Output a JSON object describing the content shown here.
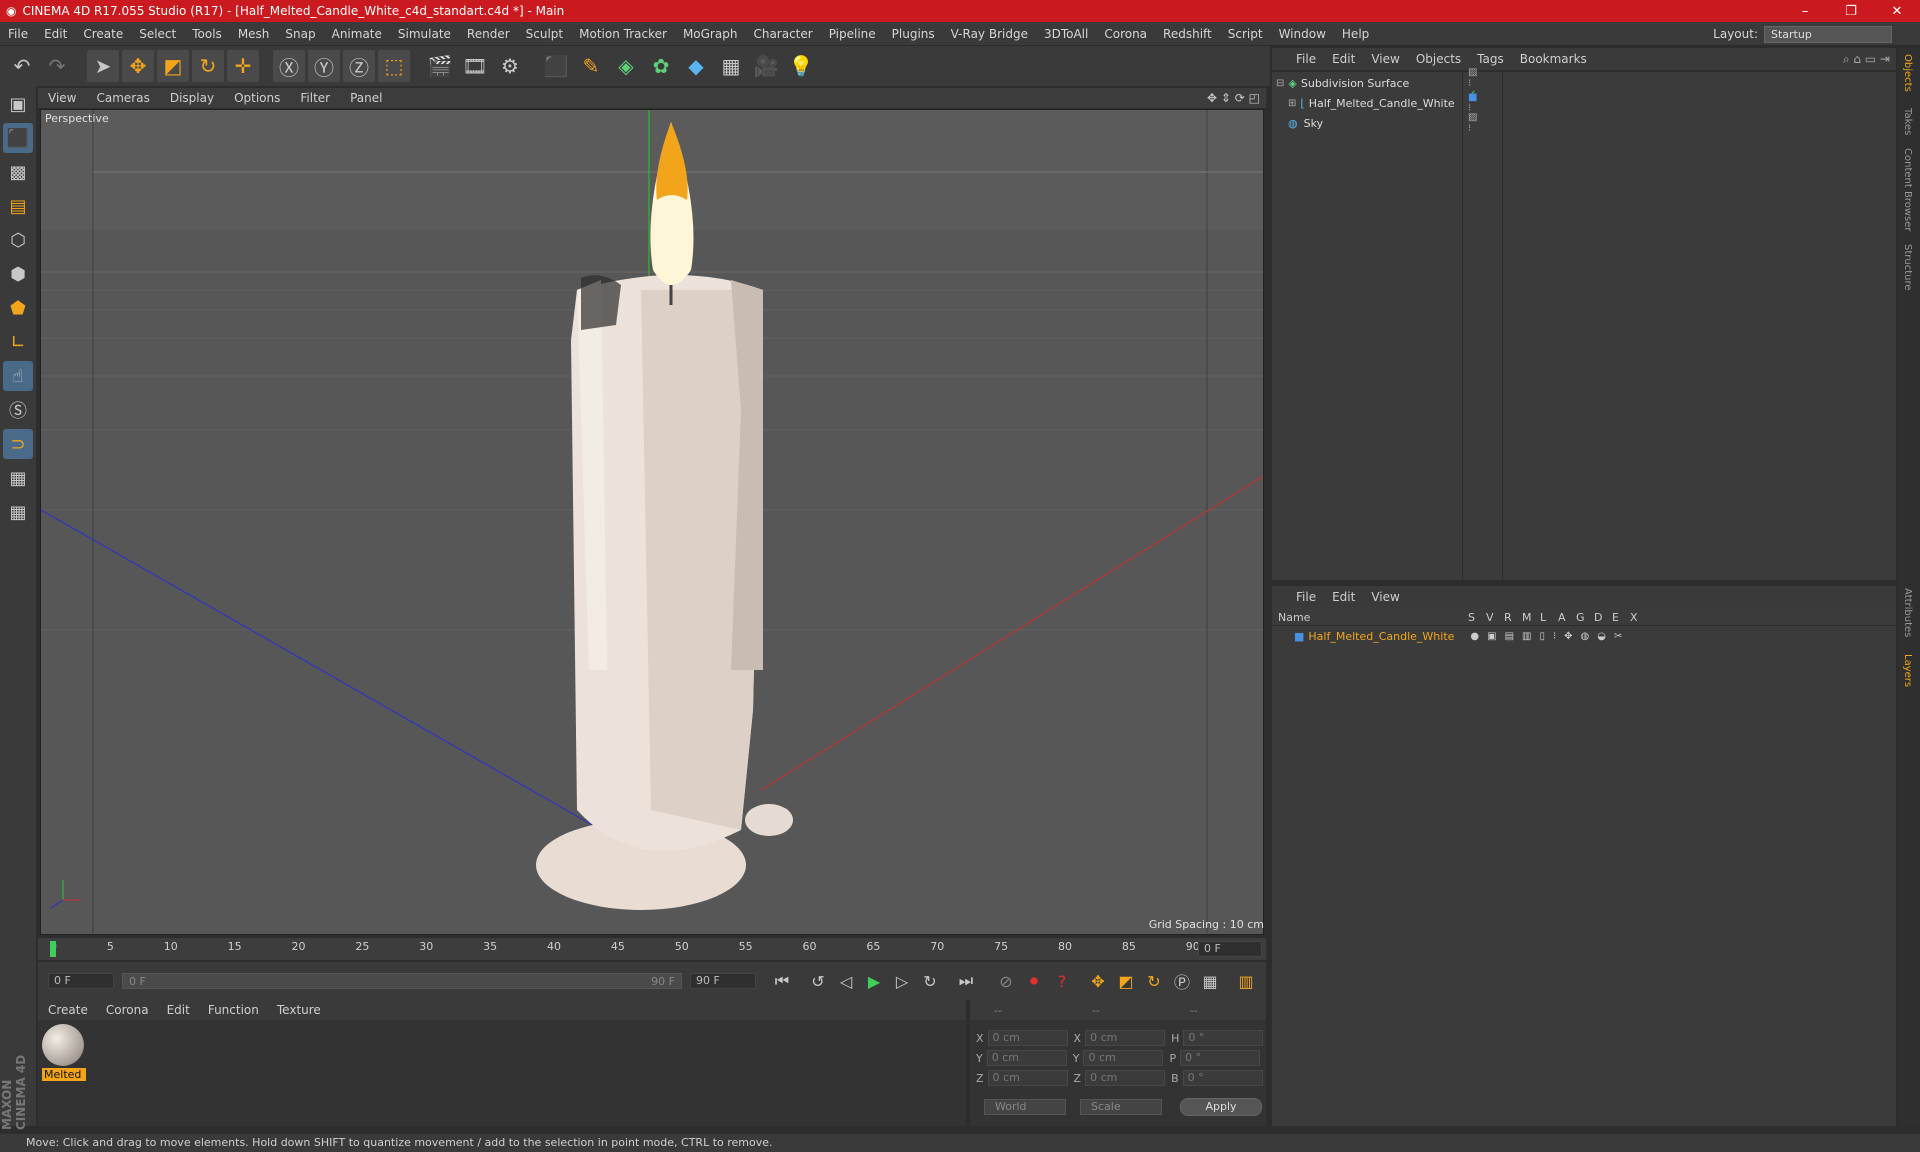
{
  "window": {
    "title": "CINEMA 4D R17.055 Studio (R17) - [Half_Melted_Candle_White_c4d_standart.c4d *] - Main",
    "controls": [
      "–",
      "❐",
      "✕"
    ]
  },
  "menubar": {
    "items": [
      "File",
      "Edit",
      "Create",
      "Select",
      "Tools",
      "Mesh",
      "Snap",
      "Animate",
      "Simulate",
      "Render",
      "Sculpt",
      "Motion Tracker",
      "MoGraph",
      "Character",
      "Pipeline",
      "Plugins",
      "V-Ray Bridge",
      "3DToAll",
      "Corona",
      "Redshift",
      "Script",
      "Window",
      "Help"
    ],
    "layout_label": "Layout:",
    "layout_value": "Startup"
  },
  "viewport": {
    "menu": [
      "View",
      "Cameras",
      "Display",
      "Options",
      "Filter",
      "Panel"
    ],
    "label": "Perspective",
    "grid_spacing": "Grid Spacing : 10 cm"
  },
  "timeline": {
    "ticks": [
      "0",
      "5",
      "10",
      "15",
      "20",
      "25",
      "30",
      "35",
      "40",
      "45",
      "50",
      "55",
      "60",
      "65",
      "70",
      "75",
      "80",
      "85",
      "90"
    ],
    "current_frame": "0 F",
    "start_field": "0 F",
    "range_start": "0 F",
    "range_end": "90 F",
    "end_field": "90 F"
  },
  "material_manager": {
    "menu": [
      "Create",
      "Corona",
      "Edit",
      "Function",
      "Texture"
    ],
    "material_name": "Melted"
  },
  "coordinates": {
    "header": [
      "--",
      "--",
      "--"
    ],
    "rows": [
      {
        "axis": "X",
        "val": "0 cm",
        "axis2": "X",
        "val2": "0 cm",
        "axis3": "H",
        "val3": "0 °"
      },
      {
        "axis": "Y",
        "val": "0 cm",
        "axis2": "Y",
        "val2": "0 cm",
        "axis3": "P",
        "val3": "0 °"
      },
      {
        "axis": "Z",
        "val": "0 cm",
        "axis2": "Z",
        "val2": "0 cm",
        "axis3": "B",
        "val3": "0 °"
      }
    ],
    "mode1": "World",
    "mode2": "Scale",
    "apply": "Apply"
  },
  "object_manager": {
    "menu": [
      "File",
      "Edit",
      "View",
      "Objects",
      "Tags",
      "Bookmarks"
    ],
    "objects": [
      {
        "name": "Subdivision Surface",
        "indent": 0
      },
      {
        "name": "Half_Melted_Candle_White",
        "indent": 1
      },
      {
        "name": "Sky",
        "indent": 0
      }
    ]
  },
  "layer_manager": {
    "menu": [
      "File",
      "Edit",
      "View"
    ],
    "columns": [
      "Name",
      "S",
      "V",
      "R",
      "M",
      "L",
      "A",
      "G",
      "D",
      "E",
      "X"
    ],
    "layers": [
      "Half_Melted_Candle_White"
    ]
  },
  "right_tabs": [
    "Objects",
    "Takes",
    "Content Browser",
    "Structure",
    "Attributes",
    "Layers"
  ],
  "status": "Move: Click and drag to move elements. Hold down SHIFT to quantize movement / add to the selection in point mode, CTRL to remove.",
  "logo": "MAXON CINEMA 4D",
  "colors": {
    "accent_orange": "#f2a51b",
    "title_red": "#cb1a1f",
    "layer_name": "#f2a51b"
  }
}
